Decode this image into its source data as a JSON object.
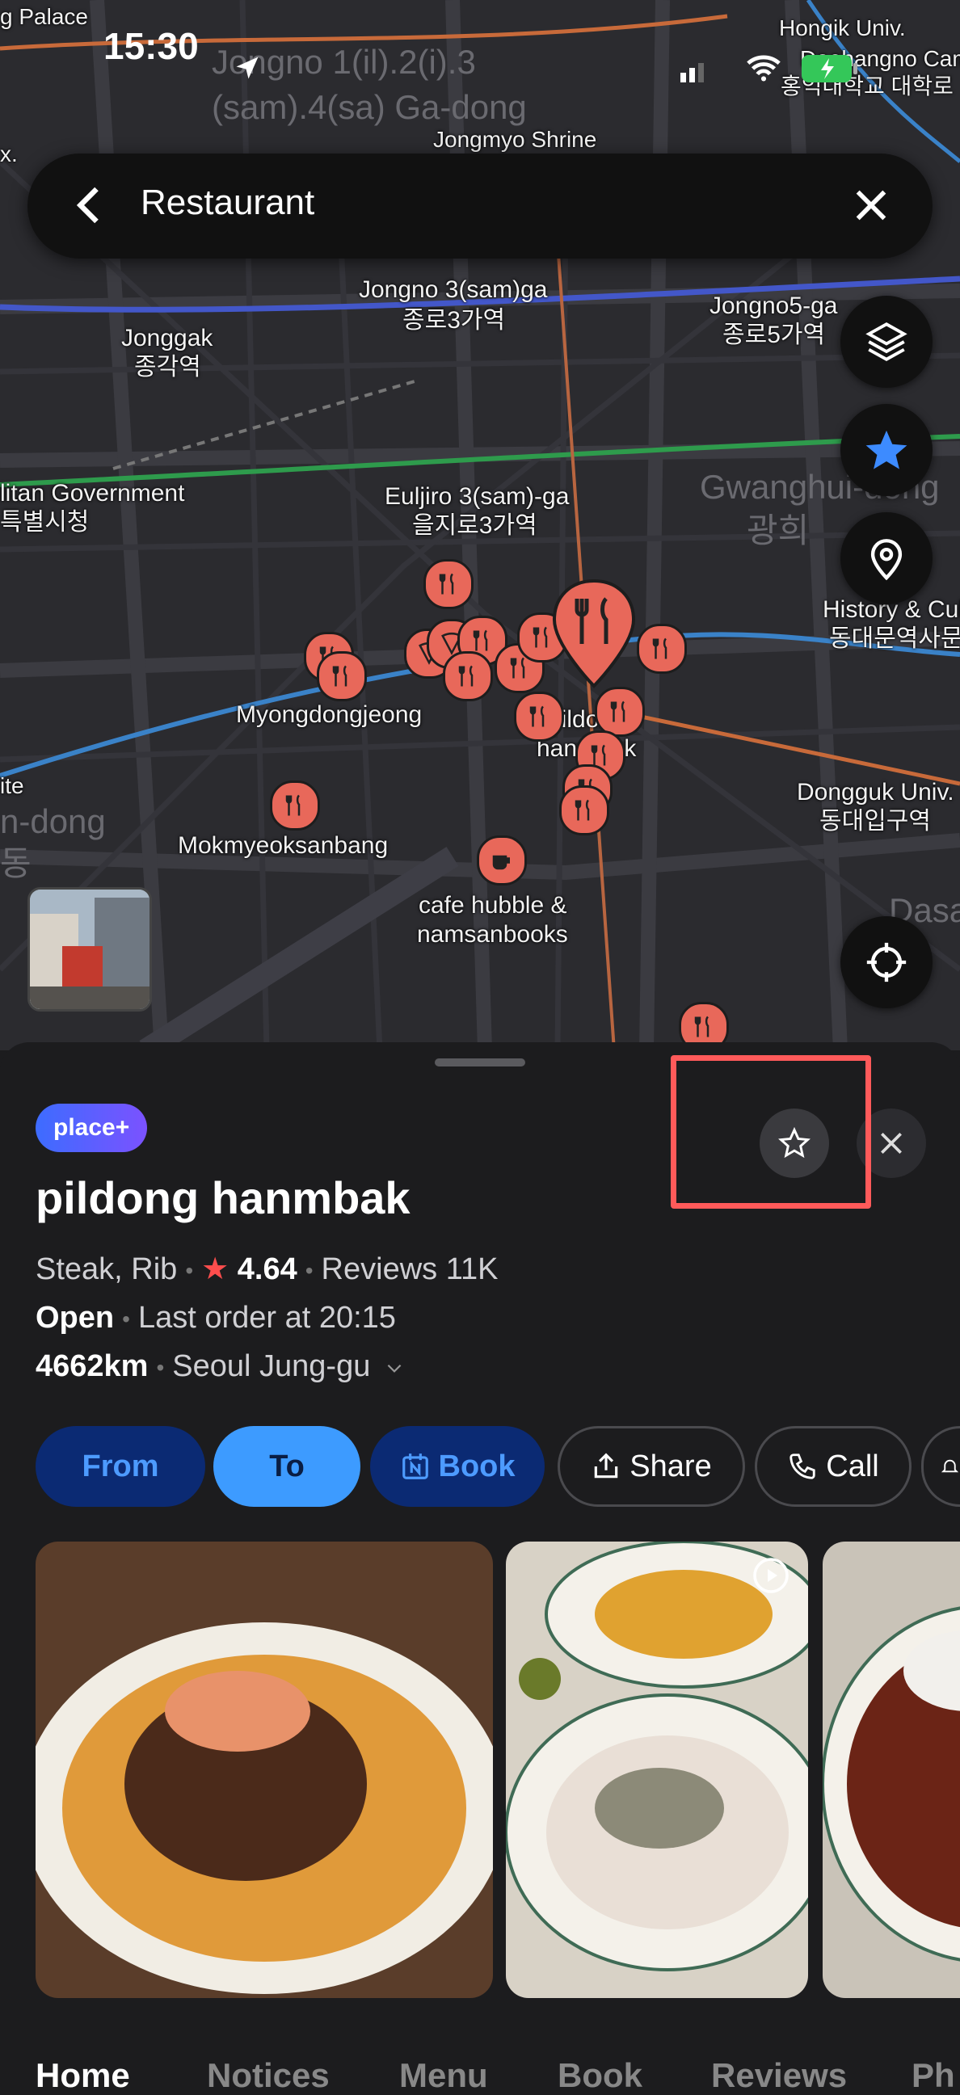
{
  "status": {
    "time": "15:30"
  },
  "search": {
    "title": "Restaurant"
  },
  "map": {
    "labels": {
      "hongik": "Hongik Univ.",
      "daehangno": "Daehangno Campus",
      "hongik_ko": "홍익대학교 대학로",
      "jongno_area": "Jongno 1(il).2(i).3",
      "jongno_area2": "(sam).4(sa) Ga-dong",
      "jongmyo": "Jongmyo Shrine",
      "palace": "g Palace",
      "jongno3": "Jongno 3(sam)ga",
      "jongno3_ko": "종로3가역",
      "jongno5": "Jongno5-ga",
      "jongno5_ko": "종로5가역",
      "jonggak": "Jonggak",
      "jonggak_ko": "종각역",
      "metro_gov": "litan Government",
      "metro_gov_ko": "특별시청",
      "euljiro3": "Euljiro 3(sam)-ga",
      "euljiro3_ko": "을지로3가역",
      "gwanghui": "Gwanghui-dong",
      "gwanghui_ko": "광희",
      "ddp": "History & Cul",
      "ddp_ko": "동대문역사문",
      "myeongdong": "Myongdongjeong",
      "pildong": "pildong",
      "hanmbak": "hanmbak",
      "dongguk": "Dongguk Univ.",
      "dongguk_ko": "동대입구역",
      "mokmyeok": "Mokmyeoksanbang",
      "cafe1": "cafe hubble &",
      "cafe2": "namsanbooks",
      "ndong": "n-dong",
      "ndong_ko": "동",
      "dasa": "Dasa",
      "ite": "ite",
      "x": "x."
    }
  },
  "place": {
    "badge": "place+",
    "name": "pildong hanmbak",
    "category": "Steak, Rib",
    "rating": "4.64",
    "reviews": "Reviews 11K",
    "status": "Open",
    "last_order": "Last order at 20:15",
    "distance": "4662km",
    "area": "Seoul Jung-gu"
  },
  "actions": {
    "from": "From",
    "to": "To",
    "book": "Book",
    "share": "Share",
    "call": "Call"
  },
  "tabs": [
    "Home",
    "Notices",
    "Menu",
    "Book",
    "Reviews",
    "Ph"
  ],
  "colors": {
    "accent": "#3d9bff",
    "pin": "#e8685a",
    "highlight": "#ff5a5a"
  }
}
